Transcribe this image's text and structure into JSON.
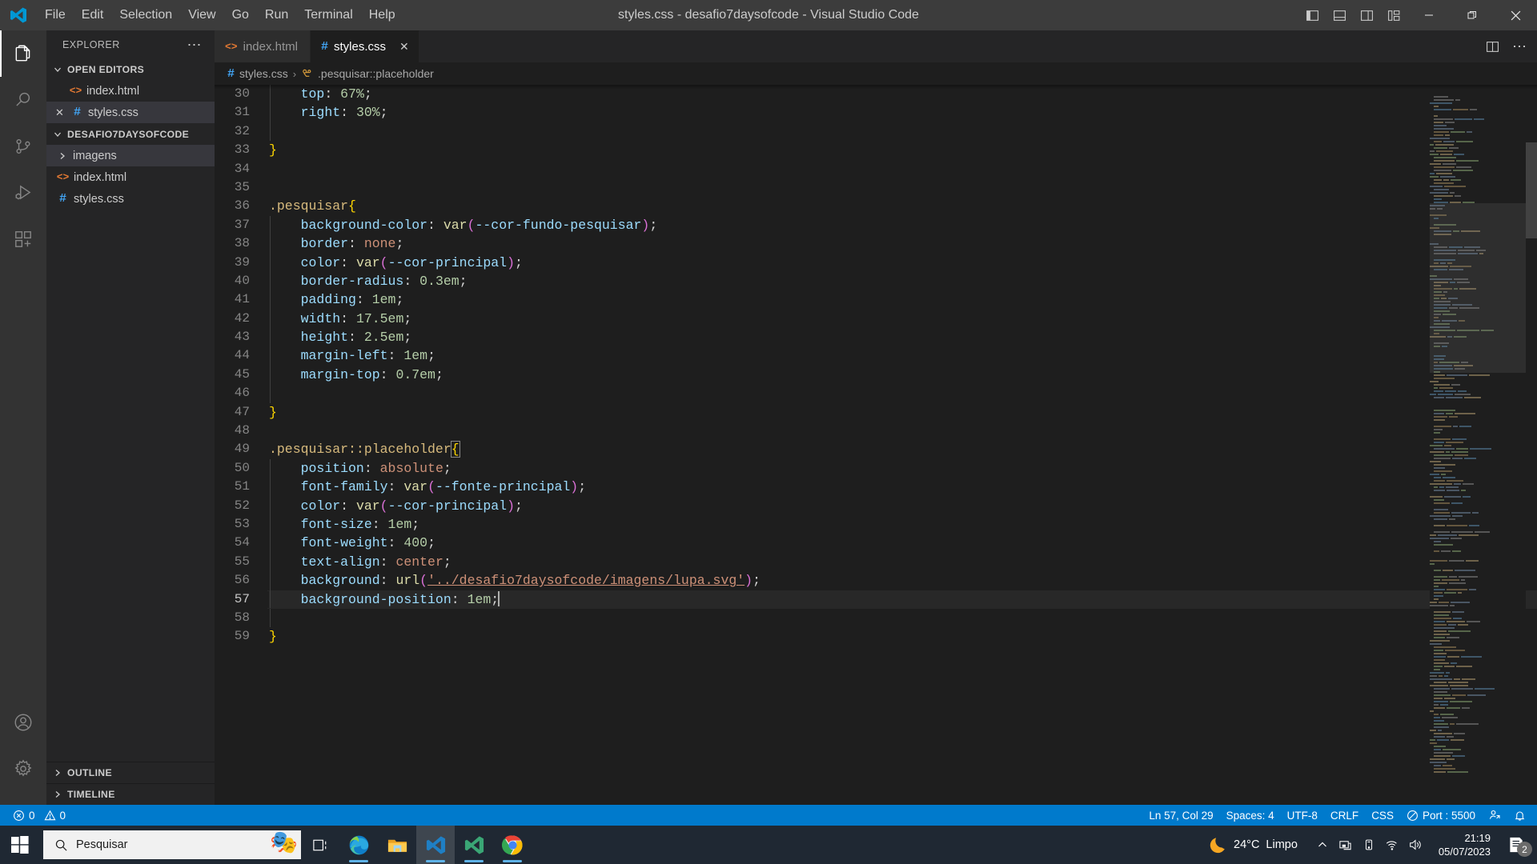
{
  "titlebar": {
    "title": "styles.css - desafio7daysofcode - Visual Studio Code",
    "menus": [
      "File",
      "Edit",
      "Selection",
      "View",
      "Go",
      "Run",
      "Terminal",
      "Help"
    ],
    "layout_buttons": [
      "toggle-primary-sidebar",
      "toggle-panel",
      "toggle-secondary-sidebar",
      "customize-layout"
    ],
    "window_buttons": [
      "minimize",
      "restore",
      "close"
    ]
  },
  "activitybar": {
    "items": [
      {
        "name": "explorer",
        "active": true
      },
      {
        "name": "search",
        "active": false
      },
      {
        "name": "source-control",
        "active": false
      },
      {
        "name": "run-and-debug",
        "active": false
      },
      {
        "name": "extensions",
        "active": false
      }
    ],
    "bottom_items": [
      {
        "name": "accounts"
      },
      {
        "name": "manage-settings"
      }
    ]
  },
  "sidebar": {
    "title": "EXPLORER",
    "open_editors": {
      "label": "OPEN EDITORS",
      "items": [
        {
          "name": "index.html",
          "icon": "html-icon",
          "selected": false,
          "dirty": false
        },
        {
          "name": "styles.css",
          "icon": "css-icon",
          "selected": true,
          "dirty": false
        }
      ]
    },
    "project": {
      "label": "DESAFIO7DAYSOFCODE",
      "items": [
        {
          "name": "imagens",
          "icon": "folder-icon",
          "selected": true
        },
        {
          "name": "index.html",
          "icon": "html-icon",
          "selected": false
        },
        {
          "name": "styles.css",
          "icon": "css-icon",
          "selected": false
        }
      ]
    },
    "outline_label": "OUTLINE",
    "timeline_label": "TIMELINE"
  },
  "tabs": [
    {
      "label": "index.html",
      "icon": "html-icon",
      "active": false,
      "closable": false
    },
    {
      "label": "styles.css",
      "icon": "css-icon",
      "active": true,
      "closable": true
    }
  ],
  "tab_actions": [
    "split-editor-right",
    "more-actions"
  ],
  "breadcrumbs": {
    "file": "styles.css",
    "symbol": ".pesquisar::placeholder",
    "separator": "›"
  },
  "editor": {
    "first_line": 30,
    "current_line": 57,
    "lines": [
      {
        "n": 30,
        "indent": true,
        "tokens": [
          {
            "t": "    ",
            "c": "t-punc"
          },
          {
            "t": "top",
            "c": "t-prop"
          },
          {
            "t": ": ",
            "c": "t-punc"
          },
          {
            "t": "67%",
            "c": "t-num"
          },
          {
            "t": ";",
            "c": "t-punc"
          }
        ]
      },
      {
        "n": 31,
        "indent": true,
        "tokens": [
          {
            "t": "    ",
            "c": "t-punc"
          },
          {
            "t": "right",
            "c": "t-prop"
          },
          {
            "t": ": ",
            "c": "t-punc"
          },
          {
            "t": "30%",
            "c": "t-num"
          },
          {
            "t": ";",
            "c": "t-punc"
          }
        ]
      },
      {
        "n": 32,
        "indent": true,
        "tokens": []
      },
      {
        "n": 33,
        "indent": false,
        "tokens": [
          {
            "t": "}",
            "c": "t-brace"
          }
        ]
      },
      {
        "n": 34,
        "indent": false,
        "tokens": []
      },
      {
        "n": 35,
        "indent": false,
        "tokens": []
      },
      {
        "n": 36,
        "indent": false,
        "tokens": [
          {
            "t": ".pesquisar",
            "c": "t-sel"
          },
          {
            "t": "{",
            "c": "t-brace"
          }
        ]
      },
      {
        "n": 37,
        "indent": true,
        "tokens": [
          {
            "t": "    ",
            "c": "t-punc"
          },
          {
            "t": "background-color",
            "c": "t-prop"
          },
          {
            "t": ": ",
            "c": "t-punc"
          },
          {
            "t": "var",
            "c": "t-fn"
          },
          {
            "t": "(",
            "c": "t-paren"
          },
          {
            "t": "--cor-fundo-pesquisar",
            "c": "t-var"
          },
          {
            "t": ")",
            "c": "t-paren"
          },
          {
            "t": ";",
            "c": "t-punc"
          }
        ]
      },
      {
        "n": 38,
        "indent": true,
        "tokens": [
          {
            "t": "    ",
            "c": "t-punc"
          },
          {
            "t": "border",
            "c": "t-prop"
          },
          {
            "t": ": ",
            "c": "t-punc"
          },
          {
            "t": "none",
            "c": "t-kw"
          },
          {
            "t": ";",
            "c": "t-punc"
          }
        ]
      },
      {
        "n": 39,
        "indent": true,
        "tokens": [
          {
            "t": "    ",
            "c": "t-punc"
          },
          {
            "t": "color",
            "c": "t-prop"
          },
          {
            "t": ": ",
            "c": "t-punc"
          },
          {
            "t": "var",
            "c": "t-fn"
          },
          {
            "t": "(",
            "c": "t-paren"
          },
          {
            "t": "--cor-principal",
            "c": "t-var"
          },
          {
            "t": ")",
            "c": "t-paren"
          },
          {
            "t": ";",
            "c": "t-punc"
          }
        ]
      },
      {
        "n": 40,
        "indent": true,
        "tokens": [
          {
            "t": "    ",
            "c": "t-punc"
          },
          {
            "t": "border-radius",
            "c": "t-prop"
          },
          {
            "t": ": ",
            "c": "t-punc"
          },
          {
            "t": "0.3em",
            "c": "t-num"
          },
          {
            "t": ";",
            "c": "t-punc"
          }
        ]
      },
      {
        "n": 41,
        "indent": true,
        "tokens": [
          {
            "t": "    ",
            "c": "t-punc"
          },
          {
            "t": "padding",
            "c": "t-prop"
          },
          {
            "t": ": ",
            "c": "t-punc"
          },
          {
            "t": "1em",
            "c": "t-num"
          },
          {
            "t": ";",
            "c": "t-punc"
          }
        ]
      },
      {
        "n": 42,
        "indent": true,
        "tokens": [
          {
            "t": "    ",
            "c": "t-punc"
          },
          {
            "t": "width",
            "c": "t-prop"
          },
          {
            "t": ": ",
            "c": "t-punc"
          },
          {
            "t": "17.5em",
            "c": "t-num"
          },
          {
            "t": ";",
            "c": "t-punc"
          }
        ]
      },
      {
        "n": 43,
        "indent": true,
        "tokens": [
          {
            "t": "    ",
            "c": "t-punc"
          },
          {
            "t": "height",
            "c": "t-prop"
          },
          {
            "t": ": ",
            "c": "t-punc"
          },
          {
            "t": "2.5em",
            "c": "t-num"
          },
          {
            "t": ";",
            "c": "t-punc"
          }
        ]
      },
      {
        "n": 44,
        "indent": true,
        "tokens": [
          {
            "t": "    ",
            "c": "t-punc"
          },
          {
            "t": "margin-left",
            "c": "t-prop"
          },
          {
            "t": ": ",
            "c": "t-punc"
          },
          {
            "t": "1em",
            "c": "t-num"
          },
          {
            "t": ";",
            "c": "t-punc"
          }
        ]
      },
      {
        "n": 45,
        "indent": true,
        "tokens": [
          {
            "t": "    ",
            "c": "t-punc"
          },
          {
            "t": "margin-top",
            "c": "t-prop"
          },
          {
            "t": ": ",
            "c": "t-punc"
          },
          {
            "t": "0.7em",
            "c": "t-num"
          },
          {
            "t": ";",
            "c": "t-punc"
          }
        ]
      },
      {
        "n": 46,
        "indent": true,
        "tokens": []
      },
      {
        "n": 47,
        "indent": false,
        "tokens": [
          {
            "t": "}",
            "c": "t-brace"
          }
        ]
      },
      {
        "n": 48,
        "indent": false,
        "tokens": []
      },
      {
        "n": 49,
        "indent": false,
        "tokens": [
          {
            "t": ".pesquisar::placeholder",
            "c": "t-sel"
          },
          {
            "t": "{",
            "c": "t-brace brace-box"
          }
        ]
      },
      {
        "n": 50,
        "indent": true,
        "tokens": [
          {
            "t": "    ",
            "c": "t-punc"
          },
          {
            "t": "position",
            "c": "t-prop"
          },
          {
            "t": ": ",
            "c": "t-punc"
          },
          {
            "t": "absolute",
            "c": "t-kw"
          },
          {
            "t": ";",
            "c": "t-punc"
          }
        ]
      },
      {
        "n": 51,
        "indent": true,
        "tokens": [
          {
            "t": "    ",
            "c": "t-punc"
          },
          {
            "t": "font-family",
            "c": "t-prop"
          },
          {
            "t": ": ",
            "c": "t-punc"
          },
          {
            "t": "var",
            "c": "t-fn"
          },
          {
            "t": "(",
            "c": "t-paren"
          },
          {
            "t": "--fonte-principal",
            "c": "t-var"
          },
          {
            "t": ")",
            "c": "t-paren"
          },
          {
            "t": ";",
            "c": "t-punc"
          }
        ]
      },
      {
        "n": 52,
        "indent": true,
        "tokens": [
          {
            "t": "    ",
            "c": "t-punc"
          },
          {
            "t": "color",
            "c": "t-prop"
          },
          {
            "t": ": ",
            "c": "t-punc"
          },
          {
            "t": "var",
            "c": "t-fn"
          },
          {
            "t": "(",
            "c": "t-paren"
          },
          {
            "t": "--cor-principal",
            "c": "t-var"
          },
          {
            "t": ")",
            "c": "t-paren"
          },
          {
            "t": ";",
            "c": "t-punc"
          }
        ]
      },
      {
        "n": 53,
        "indent": true,
        "tokens": [
          {
            "t": "    ",
            "c": "t-punc"
          },
          {
            "t": "font-size",
            "c": "t-prop"
          },
          {
            "t": ": ",
            "c": "t-punc"
          },
          {
            "t": "1em",
            "c": "t-num"
          },
          {
            "t": ";",
            "c": "t-punc"
          }
        ]
      },
      {
        "n": 54,
        "indent": true,
        "tokens": [
          {
            "t": "    ",
            "c": "t-punc"
          },
          {
            "t": "font-weight",
            "c": "t-prop"
          },
          {
            "t": ": ",
            "c": "t-punc"
          },
          {
            "t": "400",
            "c": "t-num"
          },
          {
            "t": ";",
            "c": "t-punc"
          }
        ]
      },
      {
        "n": 55,
        "indent": true,
        "tokens": [
          {
            "t": "    ",
            "c": "t-punc"
          },
          {
            "t": "text-align",
            "c": "t-prop"
          },
          {
            "t": ": ",
            "c": "t-punc"
          },
          {
            "t": "center",
            "c": "t-kw"
          },
          {
            "t": ";",
            "c": "t-punc"
          }
        ]
      },
      {
        "n": 56,
        "indent": true,
        "tokens": [
          {
            "t": "    ",
            "c": "t-punc"
          },
          {
            "t": "background",
            "c": "t-prop"
          },
          {
            "t": ": ",
            "c": "t-punc"
          },
          {
            "t": "url",
            "c": "t-fn"
          },
          {
            "t": "(",
            "c": "t-paren"
          },
          {
            "t": "'../desafio7daysofcode/imagens/lupa.svg'",
            "c": "t-link"
          },
          {
            "t": ")",
            "c": "t-paren"
          },
          {
            "t": ";",
            "c": "t-punc"
          }
        ]
      },
      {
        "n": 57,
        "indent": true,
        "highlight": true,
        "tokens": [
          {
            "t": "    ",
            "c": "t-punc"
          },
          {
            "t": "background-position",
            "c": "t-prop"
          },
          {
            "t": ": ",
            "c": "t-punc"
          },
          {
            "t": "1em",
            "c": "t-num"
          },
          {
            "t": ";",
            "c": "t-punc"
          }
        ]
      },
      {
        "n": 58,
        "indent": true,
        "tokens": []
      },
      {
        "n": 59,
        "indent": false,
        "tokens": [
          {
            "t": "}",
            "c": "t-brace"
          }
        ]
      }
    ]
  },
  "statusbar": {
    "errors": "0",
    "warnings": "0",
    "line_col": "Ln 57, Col 29",
    "spaces": "Spaces: 4",
    "encoding": "UTF-8",
    "eol": "CRLF",
    "language": "CSS",
    "live_server": "Port : 5500",
    "remote_icon": "remote-window-icon",
    "bell_icon": "bell-icon"
  },
  "taskbar": {
    "start_label": "start-button",
    "search_placeholder": "Pesquisar",
    "apps": [
      {
        "name": "task-view",
        "running": false,
        "active": false
      },
      {
        "name": "microsoft-edge",
        "running": true,
        "active": false
      },
      {
        "name": "file-explorer",
        "running": false,
        "active": false
      },
      {
        "name": "visual-studio-code",
        "running": true,
        "active": true
      },
      {
        "name": "vs-code-insiders",
        "running": true,
        "active": false
      },
      {
        "name": "google-chrome",
        "running": true,
        "active": false
      }
    ],
    "weather": {
      "temp": "24°C",
      "condition": "Limpo",
      "icon": "moon-icon"
    },
    "tray_icons": [
      "chevron-up-icon",
      "onedrive-icon",
      "bluetooth-icon",
      "wifi-icon",
      "volume-icon"
    ],
    "clock": {
      "time": "21:19",
      "date": "05/07/2023"
    },
    "notifications": {
      "count": "2"
    }
  },
  "colors": {
    "accent": "#007acc",
    "titlebar_bg": "#3c3c3c",
    "sidebar_bg": "#252526",
    "editor_bg": "#1e1e1e",
    "activitybar_bg": "#333333",
    "taskbar_bg": "#1f2833"
  }
}
